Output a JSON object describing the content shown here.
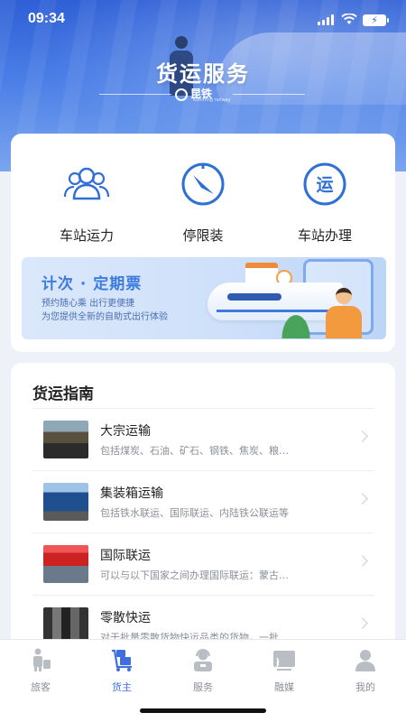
{
  "status_bar": {
    "time": "09:34"
  },
  "header": {
    "title": "货运服务",
    "logo_text": "昆铁",
    "logo_sub": "Kunming railway"
  },
  "quick_actions": [
    {
      "label": "车站运力",
      "icon": "users-icon"
    },
    {
      "label": "停限装",
      "icon": "no-loading-icon"
    },
    {
      "label": "车站办理",
      "icon": "transport-badge-icon",
      "glyph": "运"
    }
  ],
  "promo": {
    "title": "计次 · 定期票",
    "line1": "预约随心乘  出行更便捷",
    "line2": "为您提供全新的自助式出行体验"
  },
  "guide": {
    "title": "货运指南",
    "items": [
      {
        "title": "大宗运输",
        "desc": "包括煤炭、石油、矿石、钢铁、焦炭、粮…"
      },
      {
        "title": "集装箱运输",
        "desc": "包括铁水联运、国际联运、内陆铁公联运等"
      },
      {
        "title": "国际联运",
        "desc": "可以与以下国家之间办理国际联运：蒙古…"
      },
      {
        "title": "零散快运",
        "desc": "对于批量零散货物快运品类的货物，一批…"
      }
    ]
  },
  "tabbar": {
    "items": [
      {
        "label": "旅客",
        "active": false
      },
      {
        "label": "货主",
        "active": true
      },
      {
        "label": "服务",
        "active": false
      },
      {
        "label": "融媒",
        "active": false
      },
      {
        "label": "我的",
        "active": false
      }
    ]
  },
  "colors": {
    "primary": "#3d6fe0",
    "icon_blue": "#2f6fd6",
    "inactive": "#8a8f98"
  }
}
